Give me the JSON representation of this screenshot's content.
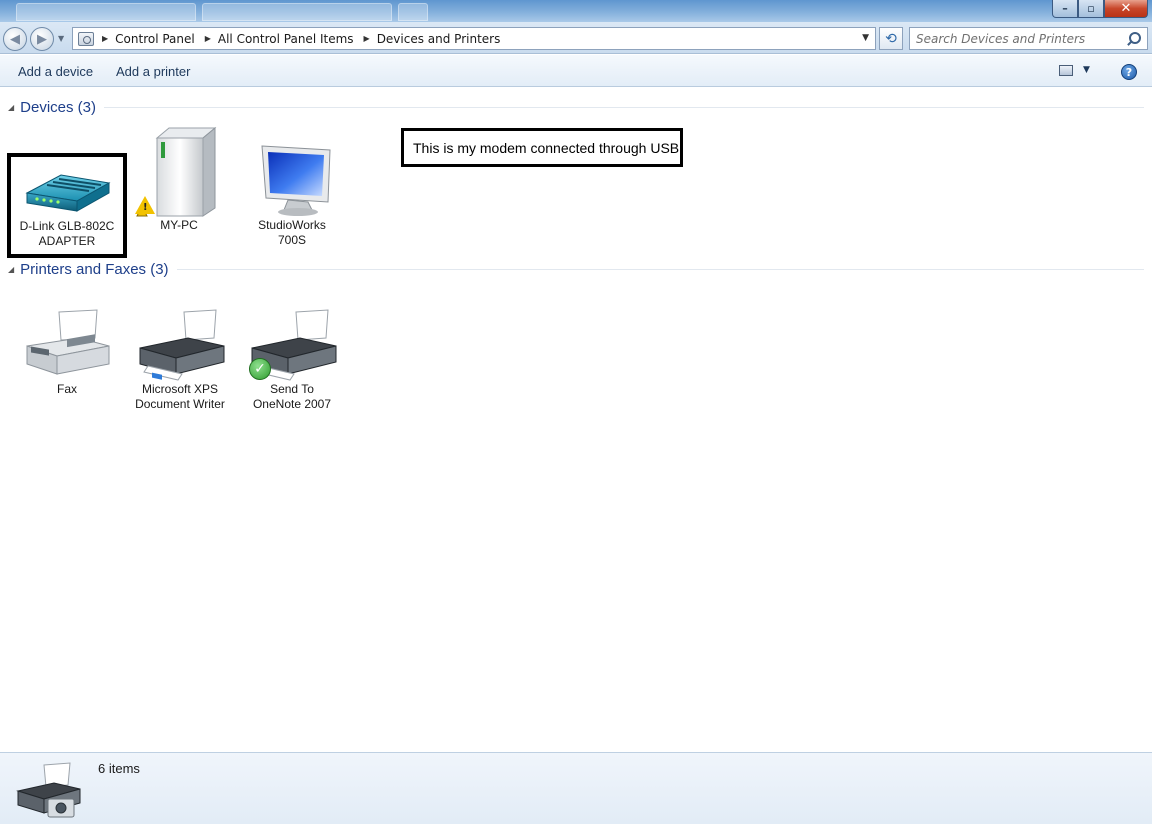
{
  "window": {
    "min_glyph": "–",
    "max_glyph": "▫",
    "close_glyph": "✕"
  },
  "address": {
    "breadcrumbs": [
      "Control Panel",
      "All Control Panel Items",
      "Devices and Printers"
    ],
    "search_placeholder": "Search Devices and Printers"
  },
  "commands": {
    "add_device": "Add a device",
    "add_printer": "Add a printer",
    "help": "?"
  },
  "groups": {
    "devices": {
      "title": "Devices (3)",
      "items": [
        {
          "label_lines": [
            "D-Link GLB-802C",
            "ADAPTER"
          ],
          "icon": "modem-icon"
        },
        {
          "label_lines": [
            "MY-PC"
          ],
          "icon": "computer-tower-icon",
          "badge": "warning-icon"
        },
        {
          "label_lines": [
            "StudioWorks",
            "700S"
          ],
          "icon": "monitor-icon"
        }
      ]
    },
    "printers": {
      "title": "Printers and Faxes (3)",
      "items": [
        {
          "label_lines": [
            "Fax"
          ],
          "icon": "fax-icon"
        },
        {
          "label_lines": [
            "Microsoft XPS",
            "Document Writer"
          ],
          "icon": "printer-icon"
        },
        {
          "label_lines": [
            "Send To",
            "OneNote 2007"
          ],
          "icon": "printer-icon",
          "badge": "default-check-icon"
        }
      ]
    }
  },
  "annotation": {
    "text": "This is my modem connected through USB"
  },
  "details": {
    "item_count": "6 items"
  },
  "colors": {
    "group_title": "#1e3f8a",
    "command_text": "#1e395b",
    "close_button": "#c8462a",
    "warning": "#f2c200",
    "check": "#2e9b2e"
  }
}
